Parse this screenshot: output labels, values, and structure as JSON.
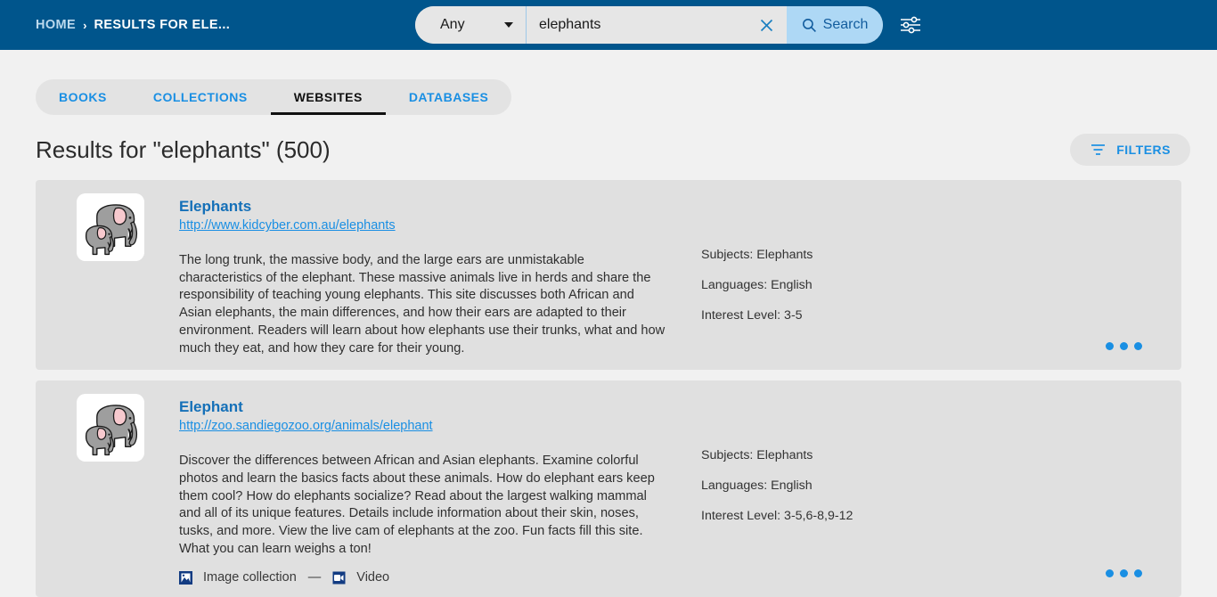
{
  "header": {
    "breadcrumb": {
      "home": "HOME",
      "separator": "›",
      "current": "RESULTS FOR ELE..."
    },
    "search": {
      "scope_selected": "Any",
      "query_value": "elephants",
      "query_placeholder": "Search",
      "clear_icon": "close-icon",
      "search_button_label": "Search",
      "search_icon": "search-icon"
    },
    "tune_icon": "sliders-icon",
    "colors": {
      "header_bg": "#00558c",
      "search_button_bg": "#aed8f5",
      "search_button_text": "#135d9e"
    }
  },
  "tabs": [
    {
      "label": "BOOKS",
      "active": false
    },
    {
      "label": "COLLECTIONS",
      "active": false
    },
    {
      "label": "WEBSITES",
      "active": true
    },
    {
      "label": "DATABASES",
      "active": false
    }
  ],
  "results_header": {
    "title": "Results for \"elephants\"  (500)",
    "filters_label": "FILTERS",
    "filters_icon": "funnel-icon"
  },
  "results": [
    {
      "title": "Elephants",
      "url": "http://www.kidcyber.com.au/elephants",
      "description": "The long trunk, the massive body, and the large ears are unmistakable characteristics of the elephant. These massive animals live in herds and share the responsibility of teaching young elephants. This site discusses both African and Asian elephants, the main differences, and how their ears are adapted to their environment. Readers will learn about how elephants use their trunks, what and how much they eat, and how they care for their young.",
      "thumbnail_icon": "elephants-thumbnail",
      "meta": {
        "subjects": "Subjects: Elephants",
        "languages": "Languages: English",
        "interest_level": "Interest Level: 3-5"
      },
      "media": [],
      "more_icon": "more-options-icon"
    },
    {
      "title": "Elephant",
      "url": "http://zoo.sandiegozoo.org/animals/elephant",
      "description": "Discover the differences between African and Asian elephants. Examine colorful photos and learn the basics facts about these animals. How do elephant ears keep them cool? How do elephants socialize? Read about the largest walking mammal and all of its unique features. Details include information about their skin, noses, tusks, and more. View the live cam of elephants at the zoo. Fun facts fill this site. What you can learn weighs a ton!",
      "thumbnail_icon": "elephants-thumbnail",
      "meta": {
        "subjects": "Subjects: Elephants",
        "languages": "Languages: English",
        "interest_level": "Interest Level: 3-5,6-8,9-12"
      },
      "media": [
        {
          "label": "Image collection",
          "icon": "image-collection-icon"
        },
        {
          "label": "Video",
          "icon": "video-icon"
        }
      ],
      "media_separator": "—",
      "more_icon": "more-options-icon"
    }
  ],
  "colors": {
    "page_bg": "#f1f1f1",
    "card_bg": "#e0e0e0",
    "link_blue": "#1a8fe3",
    "title_blue": "#1570b8"
  }
}
